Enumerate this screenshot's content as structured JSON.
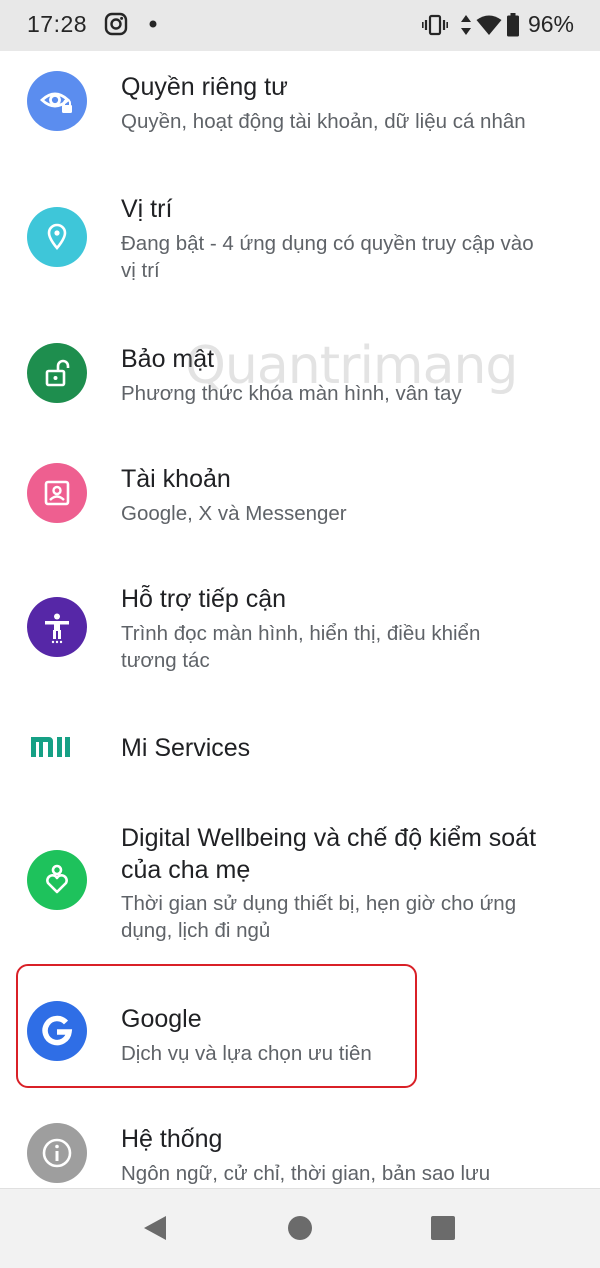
{
  "status_bar": {
    "time": "17:28",
    "battery": "96%",
    "icons": [
      "instagram-icon",
      "dot-icon",
      "vibrate-icon",
      "data-arrows-icon",
      "wifi-icon",
      "battery-icon"
    ]
  },
  "settings": {
    "items": [
      {
        "title": "Quyền riêng tư",
        "subtitle": "Quyền, hoạt động tài khoản, dữ liệu cá nhân",
        "icon": "privacy-eye-icon",
        "color": "#5b8def"
      },
      {
        "title": "Vị trí",
        "subtitle": "Đang bật - 4 ứng dụng có quyền truy cập vào vị trí",
        "icon": "location-pin-icon",
        "color": "#3ec6d9"
      },
      {
        "title": "Bảo mật",
        "subtitle": "Phương thức khóa màn hình, vân tay",
        "icon": "unlock-icon",
        "color": "#1e8e4e"
      },
      {
        "title": "Tài khoản",
        "subtitle": "Google, X và Messenger",
        "icon": "account-box-icon",
        "color": "#ee5f90"
      },
      {
        "title": "Hỗ trợ tiếp cận",
        "subtitle": "Trình đọc màn hình, hiển thị, điều khiển tương tác",
        "icon": "accessibility-icon",
        "color": "#5627a7"
      },
      {
        "title": "Mi Services",
        "icon": "mi-logo-icon",
        "color": "#16a085"
      },
      {
        "title": "Digital Wellbeing và chế độ kiểm soát của cha mẹ",
        "subtitle": "Thời gian sử dụng thiết bị, hẹn giờ cho ứng dụng, lịch đi ngủ",
        "icon": "wellbeing-heart-icon",
        "color": "#1ec25c"
      },
      {
        "title": "Google",
        "subtitle": "Dịch vụ và lựa chọn ưu tiên",
        "icon": "google-g-icon",
        "color": "#2f6ee6"
      },
      {
        "title": "Hệ thống",
        "subtitle": "Ngôn ngữ, cử chỉ, thời gian, bản sao lưu",
        "icon": "info-icon",
        "color": "#9e9e9e"
      }
    ]
  },
  "watermark": "Quantrimang",
  "nav_bar": {
    "buttons": [
      "back-icon",
      "home-icon",
      "recents-icon"
    ]
  }
}
